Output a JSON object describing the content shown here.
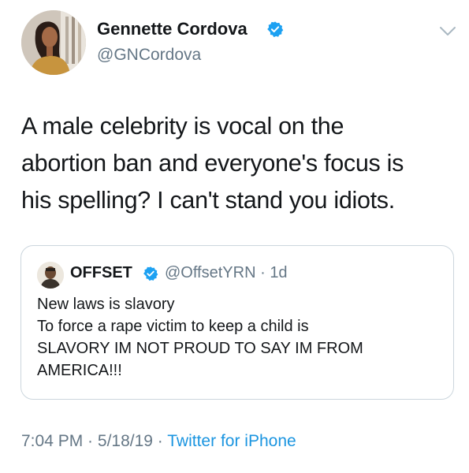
{
  "author": {
    "name": "Gennette Cordova",
    "handle": "@GNCordova",
    "verified": true
  },
  "tweet": {
    "lines": [
      "A male celebrity is vocal on the",
      "abortion ban and everyone's focus is",
      "his spelling? I can't stand you idiots."
    ]
  },
  "quoted_tweet": {
    "name": "OFFSET",
    "verified": true,
    "handle": "@OffsetYRN",
    "separator": " · ",
    "age": "1d",
    "lines": [
      "New laws is slavory",
      "To force a rape victim to keep a child is",
      "SLAVORY IM NOT PROUD TO SAY IM FROM",
      "AMERICA!!!"
    ]
  },
  "footer": {
    "time": "7:04 PM",
    "sep1": " · ",
    "date": "5/18/19",
    "sep2": " · ",
    "source": "Twitter for iPhone"
  },
  "colors": {
    "verified_blue": "#1da1f2",
    "secondary_text": "#657786",
    "link_blue": "#1b95e0",
    "border": "#ccd6dd"
  },
  "icons": {
    "verified": "verified-badge-icon",
    "menu": "chevron-down-icon"
  }
}
